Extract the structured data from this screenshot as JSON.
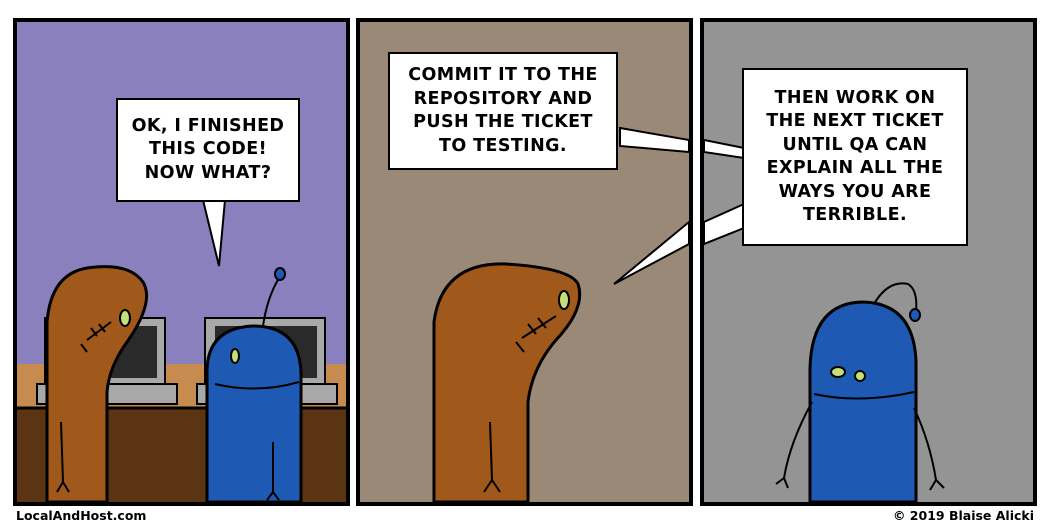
{
  "panels": [
    {
      "background": "#8a80be",
      "dialogue": "OK, I FINISHED\nTHIS CODE!\nNOW WHAT?"
    },
    {
      "background": "#9b8978",
      "dialogue": "COMMIT IT TO THE\nREPOSITORY AND\nPUSH THE TICKET\nTO TESTING."
    },
    {
      "background": "#949494",
      "dialogue": "THEN WORK ON\nTHE NEXT TICKET\nUNTIL QA CAN\nEXPLAIN ALL THE\nWAYS YOU ARE\nTERRIBLE."
    }
  ],
  "footer": {
    "site": "LocalAndHost.com",
    "copyright": "© 2019 Blaise Alicki"
  },
  "colors": {
    "brown_character": "#a1581b",
    "blue_character": "#1e5ab4",
    "desk": "#c78a4f",
    "desk_dark": "#5a3413",
    "monitor": "#a8a8a8"
  }
}
